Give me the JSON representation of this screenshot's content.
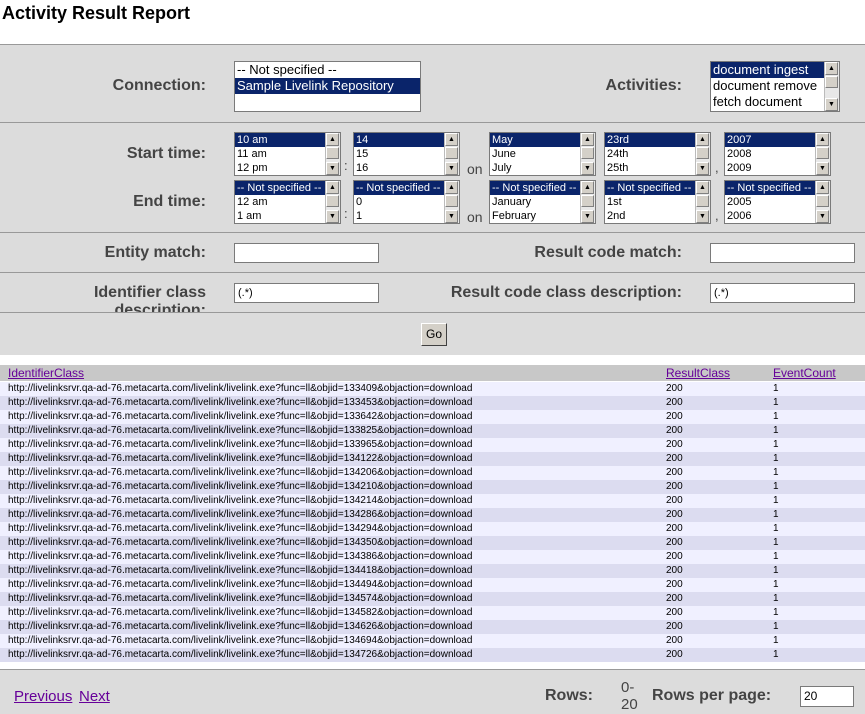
{
  "page": {
    "title": "Activity Result Report"
  },
  "filters": {
    "connection_label": "Connection:",
    "connection_options": [
      "-- Not specified --",
      "Sample Livelink Repository"
    ],
    "activities_label": "Activities:",
    "activities_options": [
      "document ingest",
      "document remove",
      "fetch document"
    ],
    "start_time_label": "Start time:",
    "end_time_label": "End time:",
    "on_label": "on",
    "colon": ":",
    "comma": ",",
    "start": {
      "hour": [
        "10 am",
        "11 am",
        "12 pm"
      ],
      "minute": [
        "14",
        "15",
        "16"
      ],
      "month": [
        "May",
        "June",
        "July"
      ],
      "day": [
        "23rd",
        "24th",
        "25th"
      ],
      "year": [
        "2007",
        "2008",
        "2009"
      ]
    },
    "end": {
      "hour": [
        "-- Not specified --",
        "12 am",
        "1 am"
      ],
      "minute": [
        "-- Not specified --",
        "0",
        "1"
      ],
      "month": [
        "-- Not specified --",
        "January",
        "February"
      ],
      "day": [
        "-- Not specified --",
        "1st",
        "2nd"
      ],
      "year": [
        "-- Not specified --",
        "2005",
        "2006"
      ]
    },
    "entity_match_label": "Entity match:",
    "entity_match_value": "",
    "result_code_match_label": "Result code match:",
    "result_code_match_value": "",
    "identifier_class_label": "Identifier class description:",
    "identifier_class_value": "(.*)",
    "result_code_class_label": "Result code class description:",
    "result_code_class_value": "(.*)",
    "go_label": "Go"
  },
  "table": {
    "columns": [
      "IdentifierClass",
      "ResultClass",
      "EventCount"
    ],
    "rows": [
      [
        "http://livelinksrvr.qa-ad-76.metacarta.com/livelink/livelink.exe?func=ll&objid=133409&objaction=download",
        "200",
        "1"
      ],
      [
        "http://livelinksrvr.qa-ad-76.metacarta.com/livelink/livelink.exe?func=ll&objid=133453&objaction=download",
        "200",
        "1"
      ],
      [
        "http://livelinksrvr.qa-ad-76.metacarta.com/livelink/livelink.exe?func=ll&objid=133642&objaction=download",
        "200",
        "1"
      ],
      [
        "http://livelinksrvr.qa-ad-76.metacarta.com/livelink/livelink.exe?func=ll&objid=133825&objaction=download",
        "200",
        "1"
      ],
      [
        "http://livelinksrvr.qa-ad-76.metacarta.com/livelink/livelink.exe?func=ll&objid=133965&objaction=download",
        "200",
        "1"
      ],
      [
        "http://livelinksrvr.qa-ad-76.metacarta.com/livelink/livelink.exe?func=ll&objid=134122&objaction=download",
        "200",
        "1"
      ],
      [
        "http://livelinksrvr.qa-ad-76.metacarta.com/livelink/livelink.exe?func=ll&objid=134206&objaction=download",
        "200",
        "1"
      ],
      [
        "http://livelinksrvr.qa-ad-76.metacarta.com/livelink/livelink.exe?func=ll&objid=134210&objaction=download",
        "200",
        "1"
      ],
      [
        "http://livelinksrvr.qa-ad-76.metacarta.com/livelink/livelink.exe?func=ll&objid=134214&objaction=download",
        "200",
        "1"
      ],
      [
        "http://livelinksrvr.qa-ad-76.metacarta.com/livelink/livelink.exe?func=ll&objid=134286&objaction=download",
        "200",
        "1"
      ],
      [
        "http://livelinksrvr.qa-ad-76.metacarta.com/livelink/livelink.exe?func=ll&objid=134294&objaction=download",
        "200",
        "1"
      ],
      [
        "http://livelinksrvr.qa-ad-76.metacarta.com/livelink/livelink.exe?func=ll&objid=134350&objaction=download",
        "200",
        "1"
      ],
      [
        "http://livelinksrvr.qa-ad-76.metacarta.com/livelink/livelink.exe?func=ll&objid=134386&objaction=download",
        "200",
        "1"
      ],
      [
        "http://livelinksrvr.qa-ad-76.metacarta.com/livelink/livelink.exe?func=ll&objid=134418&objaction=download",
        "200",
        "1"
      ],
      [
        "http://livelinksrvr.qa-ad-76.metacarta.com/livelink/livelink.exe?func=ll&objid=134494&objaction=download",
        "200",
        "1"
      ],
      [
        "http://livelinksrvr.qa-ad-76.metacarta.com/livelink/livelink.exe?func=ll&objid=134574&objaction=download",
        "200",
        "1"
      ],
      [
        "http://livelinksrvr.qa-ad-76.metacarta.com/livelink/livelink.exe?func=ll&objid=134582&objaction=download",
        "200",
        "1"
      ],
      [
        "http://livelinksrvr.qa-ad-76.metacarta.com/livelink/livelink.exe?func=ll&objid=134626&objaction=download",
        "200",
        "1"
      ],
      [
        "http://livelinksrvr.qa-ad-76.metacarta.com/livelink/livelink.exe?func=ll&objid=134694&objaction=download",
        "200",
        "1"
      ],
      [
        "http://livelinksrvr.qa-ad-76.metacarta.com/livelink/livelink.exe?func=ll&objid=134726&objaction=download",
        "200",
        "1"
      ]
    ]
  },
  "footer": {
    "previous_label": "Previous",
    "next_label": "Next",
    "rows_label": "Rows:",
    "rows_value_top": "0-",
    "rows_value_bottom": "20",
    "rows_per_page_label": "Rows per page:",
    "rows_per_page_value": "20"
  }
}
